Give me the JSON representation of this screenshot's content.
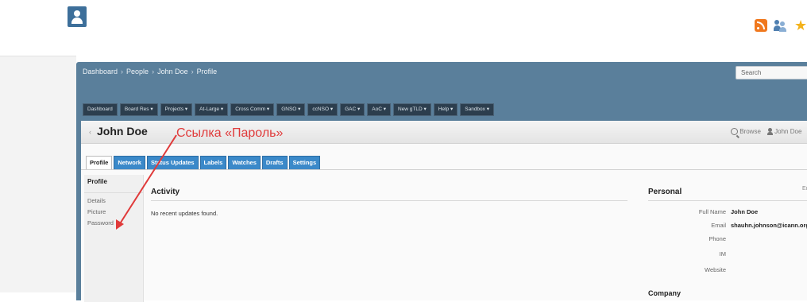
{
  "breadcrumb": {
    "items": [
      "Dashboard",
      "People",
      "John Doe",
      "Profile"
    ],
    "separator": "›"
  },
  "search": {
    "placeholder": "Search"
  },
  "navbar": {
    "items": [
      {
        "label": "Dashboard"
      },
      {
        "label": "Board Res",
        "dropdown": true
      },
      {
        "label": "Projects",
        "dropdown": true
      },
      {
        "label": "At-Large",
        "dropdown": true
      },
      {
        "label": "Cross Comm",
        "dropdown": true
      },
      {
        "label": "GNSO",
        "dropdown": true
      },
      {
        "label": "ccNSO",
        "dropdown": true
      },
      {
        "label": "GAC",
        "dropdown": true
      },
      {
        "label": "AoC",
        "dropdown": true
      },
      {
        "label": "New gTLD",
        "dropdown": true
      },
      {
        "label": "Help",
        "dropdown": true
      },
      {
        "label": "Sandbox",
        "dropdown": true
      }
    ],
    "dropdown_marker": "▾"
  },
  "page": {
    "title": "John Doe",
    "browse_label": "Browse",
    "user_label": "John Doe"
  },
  "tabs": [
    {
      "label": "Profile",
      "active": true
    },
    {
      "label": "Network"
    },
    {
      "label": "Status Updates"
    },
    {
      "label": "Labels"
    },
    {
      "label": "Watches"
    },
    {
      "label": "Drafts"
    },
    {
      "label": "Settings"
    }
  ],
  "sidebar": {
    "heading": "Profile",
    "links": [
      "Details",
      "Picture",
      "Password"
    ]
  },
  "activity": {
    "title": "Activity",
    "empty_text": "No recent updates found."
  },
  "personal": {
    "title": "Personal",
    "edit_label": "Ed",
    "fields": [
      {
        "label": "Full Name",
        "value": "John Doe"
      },
      {
        "label": "Email",
        "value": "shauhn.johnson@icann.org"
      },
      {
        "label": "Phone",
        "value": ""
      },
      {
        "label": "IM",
        "value": ""
      },
      {
        "label": "Website",
        "value": ""
      }
    ]
  },
  "company_title": "Company",
  "annotation": {
    "text": "Ссылка «Пароль»",
    "color": "#e03a3a"
  },
  "icons": [
    "user-logo-icon",
    "rss-icon",
    "people-icon",
    "star-icon",
    "user-icon",
    "search-icon"
  ],
  "colors": {
    "header_bg": "#5a7f9b",
    "nav_bg": "#2c3e4e",
    "tab_bg": "#3b89c9",
    "rss": "#f0781e",
    "star": "#f3b21b"
  }
}
